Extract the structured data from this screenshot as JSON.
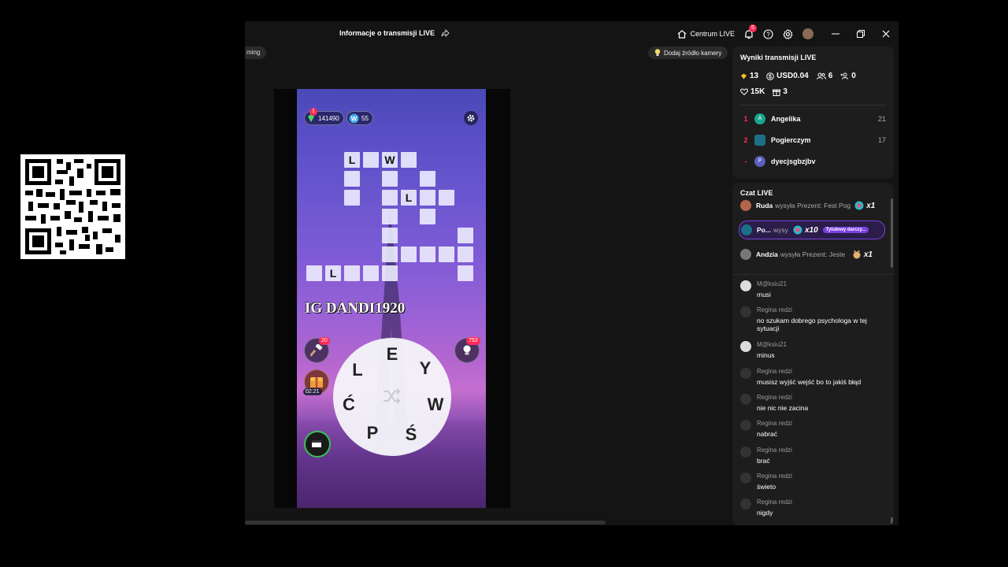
{
  "window": {
    "title": "Informacje o transmisji LIVE",
    "centrum_label": "Centrum LIVE",
    "notification_count": "5"
  },
  "toolbar": {
    "left_chip": "ming",
    "camera_button": "Dodaj źródło kamery"
  },
  "game": {
    "coins": "141490",
    "coin_badge": "1",
    "words_count": "55",
    "watermark": "IG DANDI1920",
    "hammer_count": "20",
    "hint_count": "753",
    "timer": "02:21",
    "grid_letters": {
      "l1": "L",
      "w1": "W",
      "l2": "L",
      "l3": "L"
    },
    "wheel_letters": [
      "E",
      "Y",
      "W",
      "Ś",
      "P",
      "Ć",
      "L"
    ]
  },
  "results": {
    "title": "Wyniki transmisji LIVE",
    "diamonds": "13",
    "usd": "USD0.04",
    "viewers": "6",
    "new_followers": "0",
    "likes": "15K",
    "gifts": "3",
    "ranking": [
      {
        "rank": "1",
        "name": "Angelika",
        "score": "21",
        "initial": "A",
        "color": "#1aa58e"
      },
      {
        "rank": "2",
        "name": "Pogierczym",
        "score": "17",
        "initial": "",
        "color": "#1c6f86"
      },
      {
        "rank": "-",
        "name": "dyecjsgbzjbv",
        "score": "",
        "initial": "P",
        "color": "#5a5fbf"
      }
    ]
  },
  "chat": {
    "title": "Czat LIVE",
    "gifts": [
      {
        "user": "Ruda",
        "text": "wysyła Prezent: Fest Pog",
        "count": "x1"
      },
      {
        "user": "Po...",
        "text": "wysy",
        "count": "x10",
        "tag": "Tytułowy darczy..."
      },
      {
        "user": "Andzia",
        "text": "wysyła Prezent: Jeste",
        "count": "x1"
      }
    ],
    "messages": [
      {
        "user": "M@ksiu21",
        "text": "musi"
      },
      {
        "user": "Regina redzi",
        "text": "no szukam dobrego psychologa w tej sytuacji"
      },
      {
        "user": "M@ksiu21",
        "text": "minus"
      },
      {
        "user": "Regina redzi",
        "text": "musisz wyjść wejść bo to jakiś błąd"
      },
      {
        "user": "Regina redzi",
        "text": "nie nic nie zacina"
      },
      {
        "user": "Regina redzi",
        "text": "nabrać"
      },
      {
        "user": "Regina redzi",
        "text": "brać"
      },
      {
        "user": "Regina redzi",
        "text": "świeto"
      },
      {
        "user": "Regina redzi",
        "text": "nigdy"
      }
    ]
  },
  "colors": {
    "accent": "#fe2c55",
    "panel": "#1d1d1d",
    "app_bg": "#141414",
    "gift_highlight": "#7b3fe4"
  }
}
